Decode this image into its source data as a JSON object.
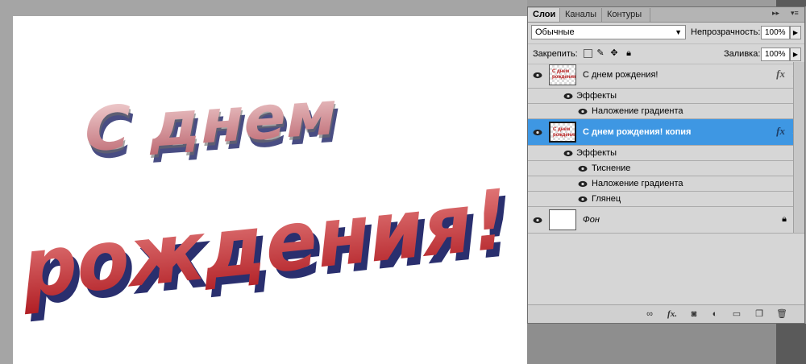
{
  "panel": {
    "tabs": [
      "Слои",
      "Каналы",
      "Контуры"
    ],
    "active_tab": "Слои",
    "blend_mode": "Обычные",
    "opacity_label": "Непрозрачность:",
    "opacity_value": "100%",
    "lock_label": "Закрепить:",
    "fill_label": "Заливка:",
    "fill_value": "100%"
  },
  "layers": [
    {
      "name": "С днем рождения!",
      "fx": "fx",
      "effects_label": "Эффекты",
      "effects": [
        "Наложение градиента"
      ]
    },
    {
      "name": "С днем рождения! копия",
      "fx": "fx",
      "selected": true,
      "effects_label": "Эффекты",
      "effects": [
        "Тиснение",
        "Наложение градиента",
        "Глянец"
      ]
    },
    {
      "name": "Фон",
      "locked": true
    }
  ],
  "thumb_text": [
    "С днем",
    "рождения"
  ],
  "canvas": {
    "line1": "С днем",
    "line2": "рождения!",
    "line1_colors": [
      "#b45a62",
      "#f4d6d6"
    ],
    "line2_colors": [
      "#b31f24",
      "#e47a7a"
    ],
    "shadow_color": "#2a2f6e"
  },
  "colors": {
    "selection": "#3e97e3",
    "panel_bg": "#d6d6d6"
  },
  "footer_icons": [
    "link-icon",
    "fx-icon",
    "mask-icon",
    "adjustment-icon",
    "group-icon",
    "new-layer-icon",
    "trash-icon"
  ]
}
